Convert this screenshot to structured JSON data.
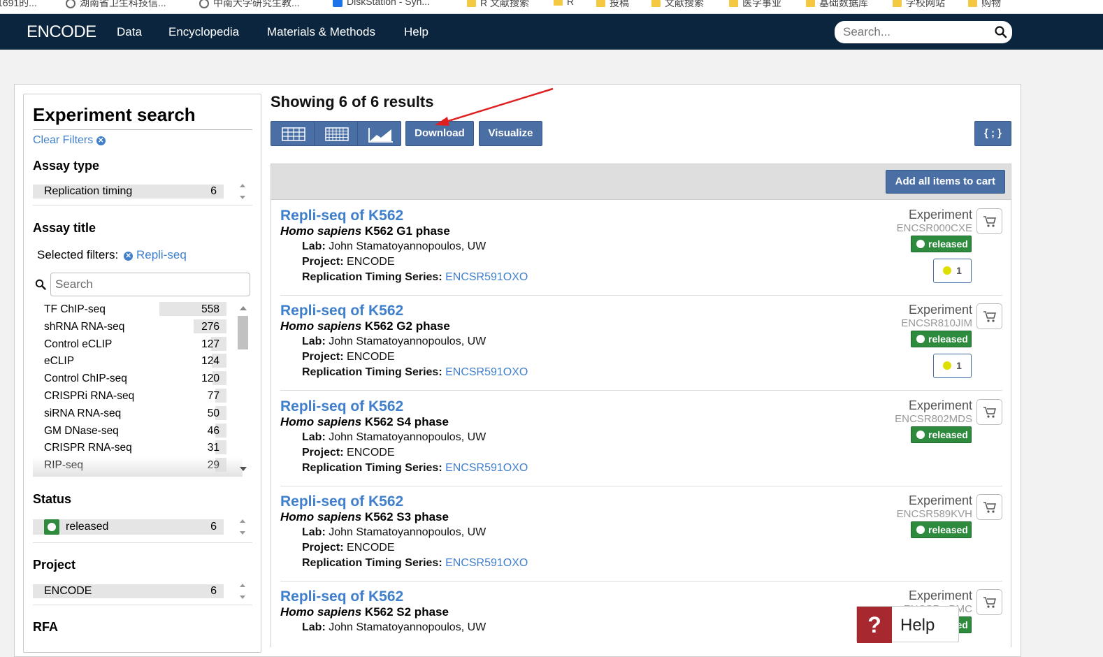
{
  "bookmarks": [
    {
      "label": "1691的...",
      "icon": "none"
    },
    {
      "label": "湖南省卫生科技信...",
      "icon": "globe-icon"
    },
    {
      "label": "中南大学研究生教...",
      "icon": "globe-icon"
    },
    {
      "label": "DiskStation - Syn...",
      "icon": "app-icon"
    },
    {
      "label": "R 文献搜索",
      "icon": "folder-icon"
    },
    {
      "label": "R",
      "icon": "folder-icon"
    },
    {
      "label": "投稿",
      "icon": "folder-icon"
    },
    {
      "label": "文献搜索",
      "icon": "folder-icon"
    },
    {
      "label": "医学事业",
      "icon": "folder-icon"
    },
    {
      "label": "基础数据库",
      "icon": "folder-icon"
    },
    {
      "label": "学校网站",
      "icon": "folder-icon"
    },
    {
      "label": "购物",
      "icon": "folder-icon"
    }
  ],
  "nav": {
    "logo": "ENCODE",
    "links": [
      "Data",
      "Encyclopedia",
      "Materials & Methods",
      "Help"
    ],
    "search_placeholder": "Search..."
  },
  "sidebar": {
    "title": "Experiment search",
    "clear_filters": "Clear Filters",
    "assay_type": {
      "heading": "Assay type",
      "term": "Replication timing",
      "count": "6"
    },
    "assay_title": {
      "heading": "Assay title",
      "selected_label": "Selected filters:",
      "selected_value": "Repli-seq",
      "search_placeholder": "Search",
      "terms": [
        {
          "label": "TF ChIP-seq",
          "count": "558",
          "fill": 1.0
        },
        {
          "label": "shRNA RNA-seq",
          "count": "276",
          "fill": 0.49
        },
        {
          "label": "Control eCLIP",
          "count": "127",
          "fill": 0.23
        },
        {
          "label": "eCLIP",
          "count": "124",
          "fill": 0.22
        },
        {
          "label": "Control ChIP-seq",
          "count": "120",
          "fill": 0.21
        },
        {
          "label": "CRISPRi RNA-seq",
          "count": "77",
          "fill": 0.14
        },
        {
          "label": "siRNA RNA-seq",
          "count": "50",
          "fill": 0.09
        },
        {
          "label": "GM DNase-seq",
          "count": "46",
          "fill": 0.08
        },
        {
          "label": "CRISPR RNA-seq",
          "count": "31",
          "fill": 0.06
        },
        {
          "label": "RIP-seq",
          "count": "29",
          "fill": 0.05
        }
      ]
    },
    "status": {
      "heading": "Status",
      "term": "released",
      "count": "6"
    },
    "project": {
      "heading": "Project",
      "term": "ENCODE",
      "count": "6"
    },
    "rfa": {
      "heading": "RFA"
    }
  },
  "results": {
    "showing": "Showing 6 of 6 results",
    "download": "Download",
    "visualize": "Visualize",
    "json": "{ ; }",
    "add_all": "Add all items to cart",
    "labels": {
      "lab": "Lab:",
      "project": "Project:",
      "series": "Replication Timing Series:",
      "type": "Experiment",
      "status": "released"
    },
    "items": [
      {
        "title": "Repli-seq of K562",
        "organism": "Homo sapiens",
        "biosample": " K562 G1 phase",
        "lab": "John Stamatoyannopoulos, UW",
        "project": "ENCODE",
        "series": "ENCSR591OXO",
        "accession": "ENCSR000CXE",
        "audit": "1"
      },
      {
        "title": "Repli-seq of K562",
        "organism": "Homo sapiens",
        "biosample": " K562 G2 phase",
        "lab": "John Stamatoyannopoulos, UW",
        "project": "ENCODE",
        "series": "ENCSR591OXO",
        "accession": "ENCSR810JIM",
        "audit": "1"
      },
      {
        "title": "Repli-seq of K562",
        "organism": "Homo sapiens",
        "biosample": " K562 S4 phase",
        "lab": "John Stamatoyannopoulos, UW",
        "project": "ENCODE",
        "series": "ENCSR591OXO",
        "accession": "ENCSR802MDS"
      },
      {
        "title": "Repli-seq of K562",
        "organism": "Homo sapiens",
        "biosample": " K562 S3 phase",
        "lab": "John Stamatoyannopoulos, UW",
        "project": "ENCODE",
        "series": "ENCSR591OXO",
        "accession": "ENCSR589KVH"
      },
      {
        "title": "Repli-seq of K562",
        "organism": "Homo sapiens",
        "biosample": " K562 S2 phase",
        "lab": "John Stamatoyannopoulos, UW",
        "accession": "ENCSR...BMC"
      }
    ]
  },
  "help": {
    "icon": "?",
    "label": "Help"
  },
  "colors": {
    "nav_bg": "#0a253d",
    "button": "#4a6fa5",
    "link": "#3f7fcb",
    "released": "#2e8b3e",
    "help_red": "#a7282e",
    "annotation_arrow": "#e02020"
  }
}
